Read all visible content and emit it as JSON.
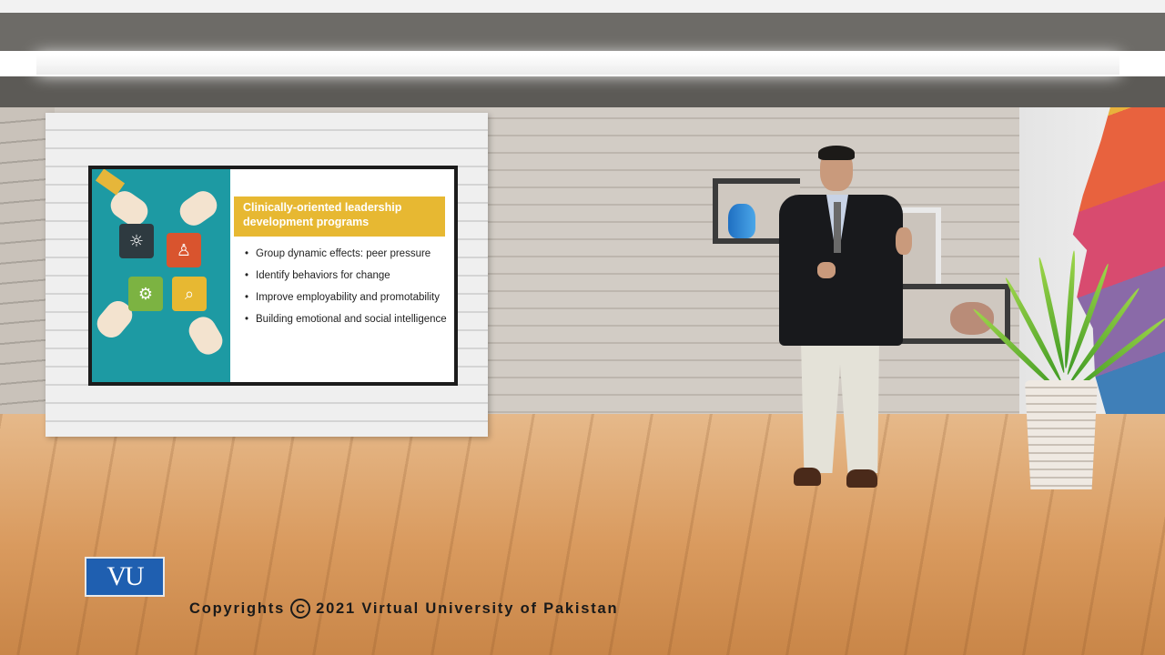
{
  "slide": {
    "title": "Clinically-oriented leadership development programs",
    "bullets": [
      "Group dynamic effects: peer pressure",
      "Identify behaviors for change",
      "Improve employability and promotability",
      "Building emotional and social intelligence"
    ]
  },
  "branding": {
    "logo_text": "VU",
    "copyright_prefix": "Copyrights",
    "copyright_symbol": "C",
    "copyright_suffix": "2021 Virtual University of Pakistan"
  },
  "colors": {
    "slide_accent": "#e7b832",
    "slide_art_bg": "#1d9aa3",
    "logo_bg": "#1f5fb0"
  },
  "icons": [
    "lightbulb-icon",
    "person-icon",
    "gear-icon",
    "magnifier-icon"
  ]
}
